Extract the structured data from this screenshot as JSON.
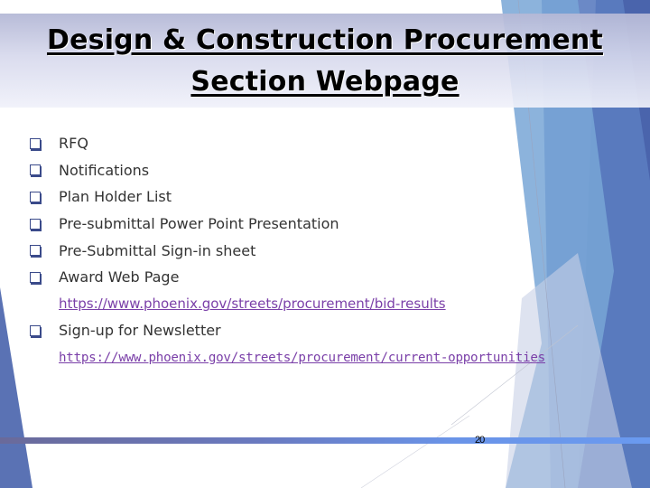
{
  "slide": {
    "title_line1": "Design & Construction Procurement",
    "title_line2": "Section Webpage",
    "items": [
      {
        "label": "RFQ",
        "bullet": "checkbox-icon"
      },
      {
        "label": "Notifications",
        "bullet": "checkbox-icon"
      },
      {
        "label": "Plan Holder List",
        "bullet": "checkbox-icon"
      },
      {
        "label": "Pre-submittal Power Point Presentation",
        "bullet": "checkbox-icon"
      },
      {
        "label": "Pre-Submittal Sign-in sheet",
        "bullet": "checkbox-icon"
      },
      {
        "label": "Award Web Page",
        "bullet": "checkbox-icon"
      }
    ],
    "award_link": "https://www.phoenix.gov/streets/procurement/bid-results",
    "newsletter_label": "Sign-up for Newsletter",
    "newsletter_link": "https://www.phoenix.gov/streets/procurement/current-opportunities",
    "page_number": "20"
  },
  "colors": {
    "link": "#7a3fa8",
    "bullet": "#3a4a8a",
    "accent_blue": "#4f6bb0",
    "light_blue": "#7aaad8",
    "footer_bar": "#6a94e8"
  }
}
